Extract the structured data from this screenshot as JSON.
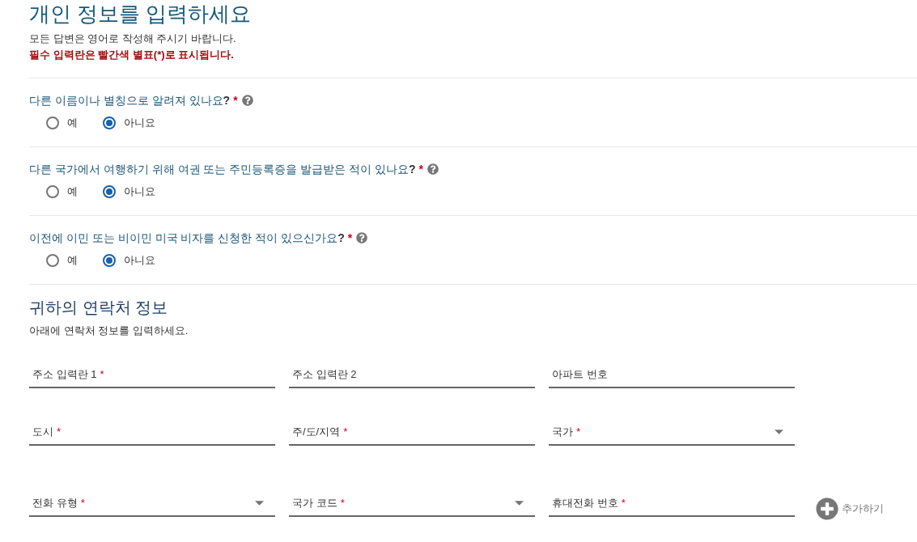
{
  "header": {
    "title": "개인 정보를 입력하세요",
    "instructions": "모든 답변은 영어로 작성해 주시기 바랍니다.",
    "required_note": "필수 입력란은 빨간색 별표(*)로 표시됩니다."
  },
  "questions": [
    {
      "label": "다른 이름이나 별칭으로 알려져 있나요**?**",
      "mark": "*",
      "options": [
        {
          "label": "예",
          "selected": false
        },
        {
          "label": "아니요",
          "selected": true
        }
      ]
    },
    {
      "label": "다른 국가에서 여행하기 위해 여권 또는 주민등록증을 발급받은 적이 있나요**?**",
      "mark": "*",
      "options": [
        {
          "label": "예",
          "selected": false
        },
        {
          "label": "아니요",
          "selected": true
        }
      ]
    },
    {
      "label": "이전에 이민 또는 비이민 미국 비자를 신청한 적이 있으신가요**?**",
      "mark": "*",
      "options": [
        {
          "label": "예",
          "selected": false
        },
        {
          "label": "아니요",
          "selected": true
        }
      ]
    }
  ],
  "contact": {
    "title": "귀하의 연락처 정보",
    "description": "아래에 연락처 정보를 입력하세요.",
    "address_fields": [
      {
        "label": "주소 입력란 1",
        "mark": "*",
        "kind": "text"
      },
      {
        "label": "주소 입력란 2",
        "kind": "text"
      },
      {
        "label": "아파트 번호",
        "kind": "text"
      },
      {
        "label": "도시",
        "mark": "*",
        "kind": "text"
      },
      {
        "label": "주/도/지역",
        "mark": "*",
        "kind": "text"
      },
      {
        "label": "국가",
        "mark": "*",
        "kind": "select"
      }
    ],
    "phone_fields": [
      {
        "label": "전화 유형",
        "mark": "*",
        "kind": "select"
      },
      {
        "label": "국가 코드",
        "mark": "*",
        "kind": "select"
      },
      {
        "label": "휴대전화 번호",
        "mark": "*",
        "kind": "text"
      }
    ],
    "add_button": {
      "label": "추가하기"
    }
  }
}
